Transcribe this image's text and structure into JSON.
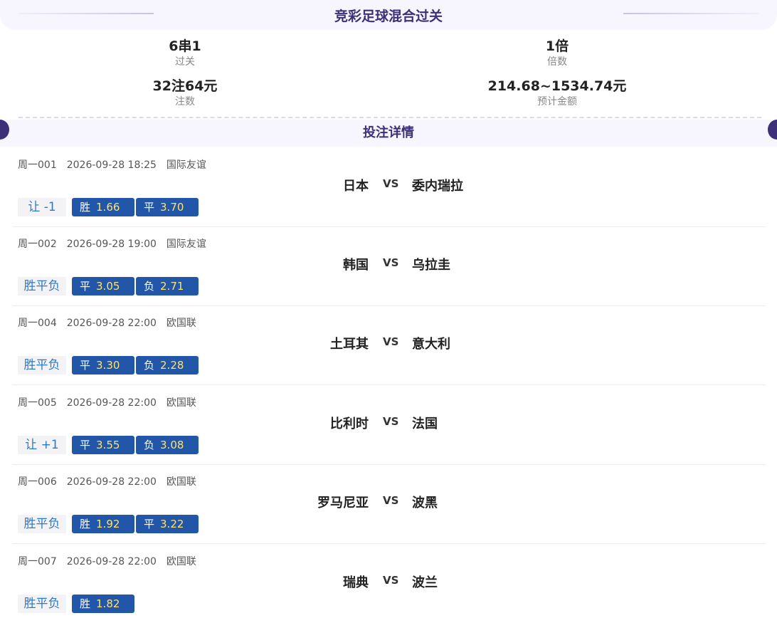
{
  "header": {
    "title": "竞彩足球混合过关"
  },
  "summary": {
    "pass_type": {
      "value": "6串1",
      "label": "过关"
    },
    "multiple": {
      "value": "1倍",
      "label": "倍数"
    },
    "bets": {
      "value": "32注64元",
      "label": "注数"
    },
    "estimate": {
      "value": "214.68~1534.74元",
      "label": "预计金额"
    }
  },
  "section_title": "投注详情",
  "vs_label": "VS",
  "matches": [
    {
      "code": "周一001",
      "time": "2026-09-28 18:25",
      "league": "国际友谊",
      "home": "日本",
      "away": "委内瑞拉",
      "play": "让 -1",
      "odds": [
        {
          "name": "胜",
          "value": "1.66"
        },
        {
          "name": "平",
          "value": "3.70"
        }
      ]
    },
    {
      "code": "周一002",
      "time": "2026-09-28 19:00",
      "league": "国际友谊",
      "home": "韩国",
      "away": "乌拉圭",
      "play": "胜平负",
      "odds": [
        {
          "name": "平",
          "value": "3.05"
        },
        {
          "name": "负",
          "value": "2.71"
        }
      ]
    },
    {
      "code": "周一004",
      "time": "2026-09-28 22:00",
      "league": "欧国联",
      "home": "土耳其",
      "away": "意大利",
      "play": "胜平负",
      "odds": [
        {
          "name": "平",
          "value": "3.30"
        },
        {
          "name": "负",
          "value": "2.28"
        }
      ]
    },
    {
      "code": "周一005",
      "time": "2026-09-28 22:00",
      "league": "欧国联",
      "home": "比利时",
      "away": "法国",
      "play": "让 +1",
      "odds": [
        {
          "name": "平",
          "value": "3.55"
        },
        {
          "name": "负",
          "value": "3.08"
        }
      ]
    },
    {
      "code": "周一006",
      "time": "2026-09-28 22:00",
      "league": "欧国联",
      "home": "罗马尼亚",
      "away": "波黑",
      "play": "胜平负",
      "odds": [
        {
          "name": "胜",
          "value": "1.92"
        },
        {
          "name": "平",
          "value": "3.22"
        }
      ]
    },
    {
      "code": "周一007",
      "time": "2026-09-28 22:00",
      "league": "欧国联",
      "home": "瑞典",
      "away": "波兰",
      "play": "胜平负",
      "odds": [
        {
          "name": "胜",
          "value": "1.82"
        }
      ]
    }
  ],
  "colors": {
    "accent": "#3d2f78",
    "odd_bg": "#2156a8",
    "odd_value": "#ffe26a",
    "play_tag": "#2a79c9"
  }
}
